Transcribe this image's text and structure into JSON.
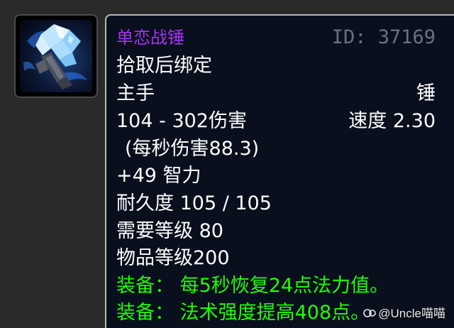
{
  "item": {
    "name": "单恋战锤",
    "id": "ID: 37169",
    "binding": "拾取后绑定",
    "slot": "主手",
    "type": "锤",
    "damage": "104 - 302伤害",
    "speed": "速度 2.30",
    "dps": "(每秒伤害88.3)",
    "stat": "+49 智力",
    "durability": "耐久度 105 / 105",
    "required_level": "需要等级 80",
    "item_level": "物品等级200",
    "equip_effects": [
      "装备：  每5秒恢复24点法力值。",
      "装备：  法术强度提高408点。"
    ]
  },
  "watermark": "@Uncle喵喵",
  "icon": "frost-crystal-mace-icon",
  "colors": {
    "epic_name": "#a335ee",
    "equip_green": "#1eff00",
    "id_gray": "#6d6f86",
    "tooltip_bg": "#0a0f1e"
  }
}
